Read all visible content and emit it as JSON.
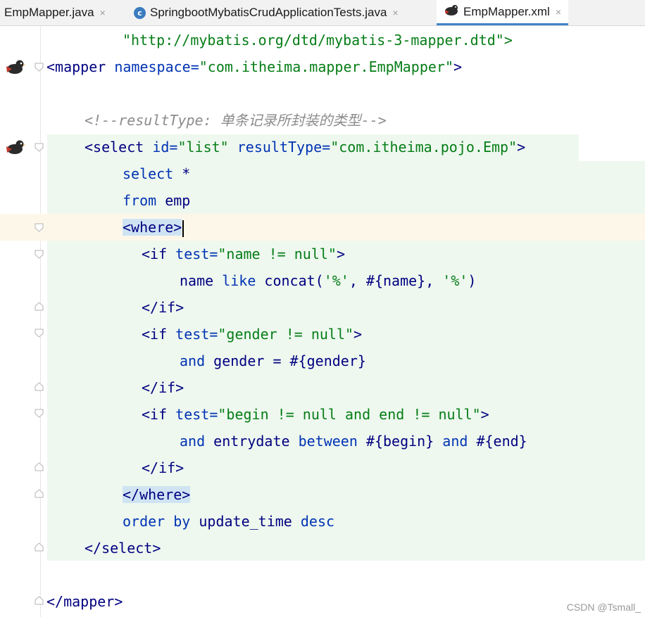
{
  "tabs": [
    {
      "label": "EmpMapper.java",
      "close": "×"
    },
    {
      "label": "SpringbootMybatisCrudApplicationTests.java",
      "icon_letter": "c",
      "close": "×"
    },
    {
      "label": "EmpMapper.xml",
      "close": "×"
    }
  ],
  "code": {
    "l1": "\"http://mybatis.org/dtd/mybatis-3-mapper.dtd\">",
    "l2": {
      "open": "<mapper ",
      "attr": "namespace=",
      "val": "\"com.itheima.mapper.EmpMapper\"",
      "close": ">"
    },
    "l4": "<!--resultType: 单条记录所封装的类型-->",
    "l5": {
      "open": "<select ",
      "attr1": "id=",
      "val1": "\"list\" ",
      "attr2": "resultType=",
      "val2": "\"com.itheima.pojo.Emp\"",
      "close": ">"
    },
    "l6": {
      "kw": "select",
      "rest": " *"
    },
    "l7": {
      "kw": "from",
      "rest": " emp"
    },
    "l8": "<where>",
    "l9": {
      "open": "<if ",
      "attr": "test=",
      "val": "\"name != null\"",
      "close": ">"
    },
    "l10": {
      "a": "name ",
      "kw": "like",
      "b": " concat(",
      "s1": "'%'",
      "c": ", #{name}, ",
      "s2": "'%'",
      "d": ")"
    },
    "l11": "</if>",
    "l12": {
      "open": "<if ",
      "attr": "test=",
      "val": "\"gender != null\"",
      "close": ">"
    },
    "l13": {
      "kw": "and",
      "rest": " gender = #{gender}"
    },
    "l14": "</if>",
    "l15": {
      "open": "<if ",
      "attr": "test=",
      "val": "\"begin != null and end != null\"",
      "close": ">"
    },
    "l16": {
      "kw1": "and",
      "a": " entrydate ",
      "kw2": "between",
      "b": " #{begin} ",
      "kw3": "and",
      "c": " #{end}"
    },
    "l17": "</if>",
    "l18": "</where>",
    "l19": {
      "kw": "order by",
      "rest": " update_time ",
      "kw2": "desc"
    },
    "l20": "</select>",
    "l22": "</mapper>"
  },
  "watermark": "CSDN @Tsmall_"
}
